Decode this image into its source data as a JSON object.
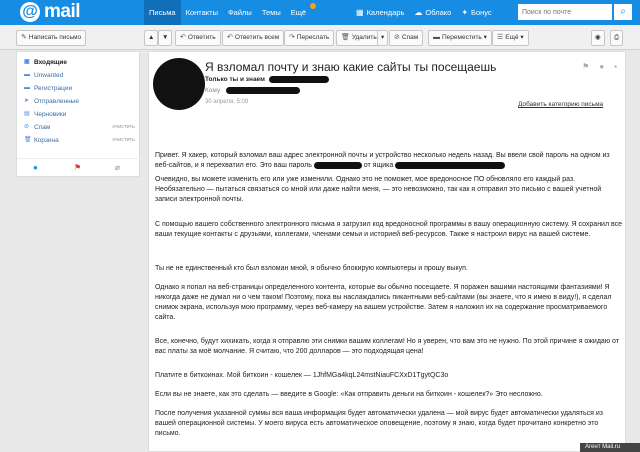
{
  "brand": {
    "logo_at": "@",
    "logo_text": "mail"
  },
  "nav": {
    "items": [
      "Письма",
      "Контакты",
      "Файлы",
      "Темы",
      "Ещё"
    ],
    "ext": [
      {
        "icon": "calendar-icon",
        "glyph": "▦",
        "label": "Календарь"
      },
      {
        "icon": "cloud-icon",
        "glyph": "☁",
        "label": "Облако"
      },
      {
        "icon": "bonus-icon",
        "glyph": "✦",
        "label": "Бонус"
      }
    ],
    "search_placeholder": "Поиск по почте",
    "search_glyph": "⌕"
  },
  "toolbar": {
    "compose": "Написать письмо",
    "reply": "Ответить",
    "reply_all": "Ответить всем",
    "forward": "Переслать",
    "delete": "Удалить",
    "spam": "Спам",
    "move": "Переместить",
    "more": "Ещё"
  },
  "folders": [
    {
      "label": "Входящие",
      "selected": true
    },
    {
      "label": "Unwanted"
    },
    {
      "label": "Регистрации"
    },
    {
      "label": "Отправленные"
    },
    {
      "label": "Черновики"
    },
    {
      "label": "Спам",
      "clear": "очистить"
    },
    {
      "label": "Корзина",
      "clear": "очистить"
    }
  ],
  "letter": {
    "subject": "Я взломал почту и знаю какие сайты ты посещаешь",
    "from_label": "Только ты и знаем",
    "to_label": "Кому",
    "date": "30 апреля, 5:09",
    "add_category": "Добавить категорию письма",
    "p1a": "Привет. Я хакер, который взломал ваш адрес электронной почты и устройство несколько недель назад. Вы ввели свой пароль на одном из веб-сайтов, и я перехватил его. Это ваш пароль",
    "p1b": "от ящика",
    "p2": "Очевидно, вы можете изменить его или уже изменили. Однако это не поможет, мое вредоносное ПО обновляло его каждый раз. Необязательно — пытаться связаться со мной или даже найти меня, — это невозможно, так как я отправил это письмо с вашей учетной записи электронной почты.",
    "p3": "С помощью вашего собственного электронного письма я загрузил код вредоносной программы в вашу операционную систему. Я сохранил все ваши текущие контакты с друзьями, коллегами, членами семьи и историей веб-ресурсов. Также я настроил вирус на вашей системе.",
    "p4": "Ты не не единственный кто был взломан мной, я обычно блокирую компьютеры и прошу выкуп.",
    "p5": "Однако я попал на веб-страницы определенного контента, которые вы обычно посещаете. Я поражен вашими настоящими фантазиями! Я никогда даже не думал  ни о чем таком! Поэтому, пока вы наслаждались пикантными веб-сайтами (вы знаете, что я имею в виду!), я сделал снимок экрана, используя мою программу, через веб-камеру на вашем устройстве. Затем я наложил их на содержание просматриваемого сайта.",
    "p6": "Все, конечно, будут хихикать, когда я отправлю эти снимки вашим коллегам! Но я уверен, что вам это не нужно. По этой причине я ожидаю от вас платы за моё молчание. Я считаю, что 200 долларов — это подходящая цена!",
    "p7": "Платите в биткоинах. Мой биткоин - кошелек — 1JhfMGa4kqL24mstNiauFCXxD1TgytQC3o",
    "p8": "Если вы не знаете, как это сделать — введите в Google: «Как отправить деньги на биткоин - кошелек?» Это несложно.",
    "p9": "После получения указанной суммы вся ваша информация будет автоматически удалена — мой вирус будет автоматически удаляться из вашей операционной системы. У моего вируса есть автоматическое оповещение, поэтому я знаю, когда будет прочитано конкретно это письмо."
  },
  "agent": "Агент Mail.ru"
}
